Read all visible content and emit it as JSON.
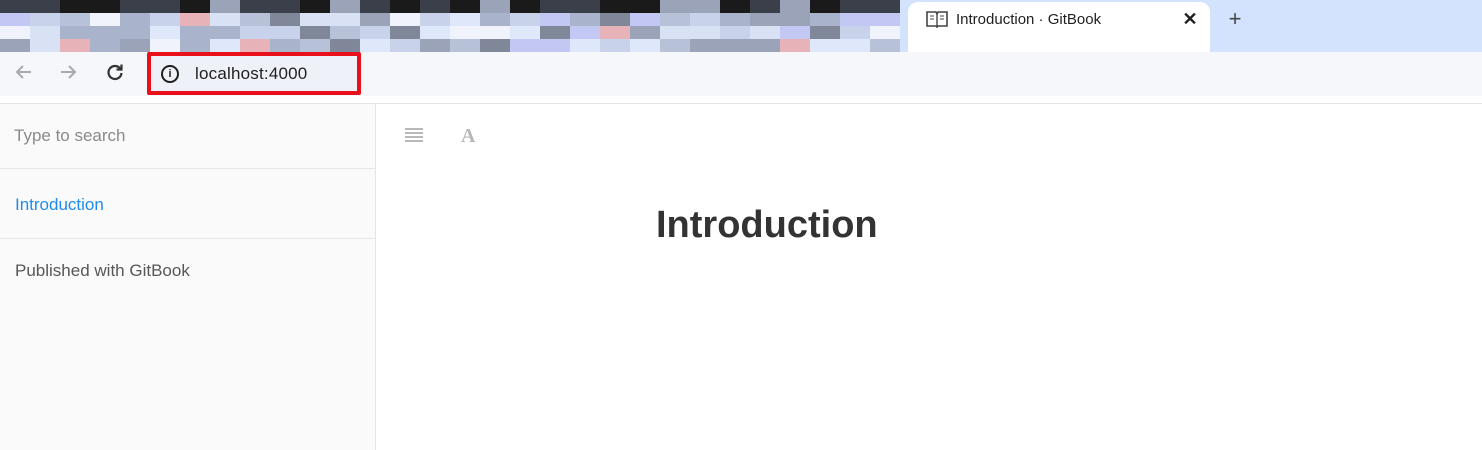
{
  "browser": {
    "tab": {
      "title": "Introduction · GitBook",
      "close_label": "✕",
      "favicon": "book-icon"
    },
    "new_tab_label": "+",
    "nav": {
      "back_icon": "back-arrow-icon",
      "forward_icon": "forward-arrow-icon",
      "reload_icon": "reload-icon"
    },
    "address_bar": {
      "url": "localhost:4000",
      "info_icon": "info-icon",
      "highlight_color": "#e8101a"
    }
  },
  "sidebar": {
    "search": {
      "placeholder": "Type to search",
      "value": ""
    },
    "items": [
      {
        "label": "Introduction",
        "active": true
      }
    ],
    "footer_label": "Published with GitBook",
    "active_color": "#1f8ced"
  },
  "content": {
    "toolbar": {
      "toc_icon": "toc-toggle-icon",
      "font_icon": "font-settings-icon",
      "font_glyph": "A"
    },
    "title": "Introduction"
  }
}
